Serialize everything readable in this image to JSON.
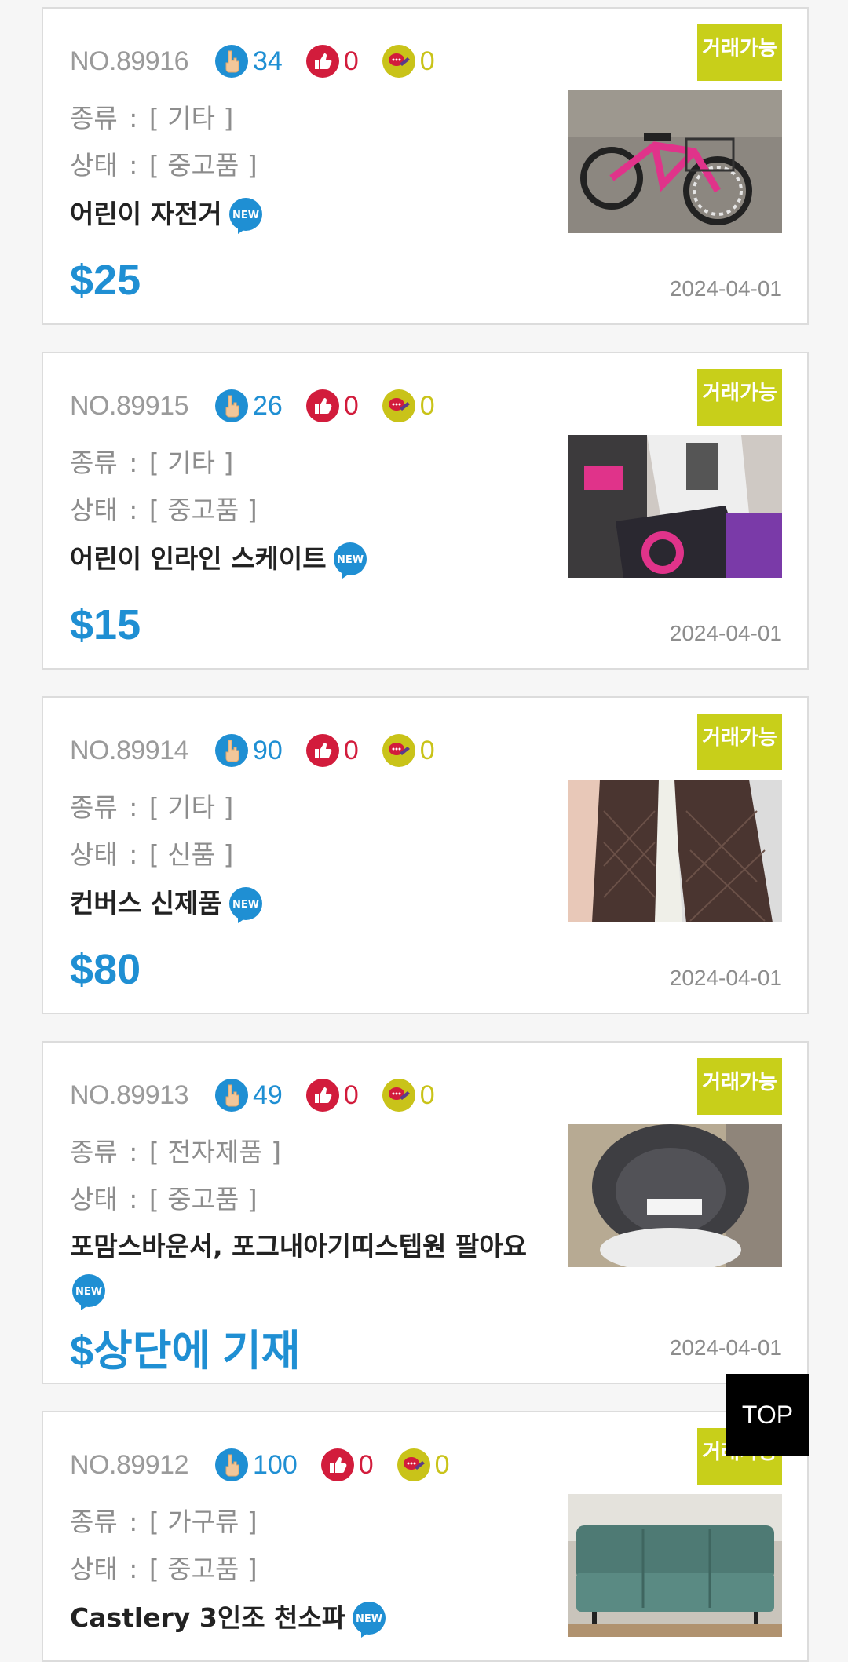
{
  "colors": {
    "accent_blue": "#1f8fd3",
    "like_red": "#d21c3c",
    "chat_olive": "#c9c319",
    "status_green": "#c8cf1a"
  },
  "labels": {
    "category_label": "종류",
    "condition_label": "상태",
    "colon": ":",
    "new_badge": "NEW"
  },
  "top_button": "TOP",
  "items": [
    {
      "no": "NO.89916",
      "views": "34",
      "likes": "0",
      "comments": "0",
      "category": "[ 기타 ]",
      "condition": "[ 중고품 ]",
      "title": "어린이 자전거",
      "price": "$25",
      "date": "2024-04-01",
      "status": "거래가능",
      "thumbnail_icon": "bicycle-photo"
    },
    {
      "no": "NO.89915",
      "views": "26",
      "likes": "0",
      "comments": "0",
      "category": "[ 기타 ]",
      "condition": "[ 중고품 ]",
      "title": "어린이 인라인 스케이트",
      "price": "$15",
      "date": "2024-04-01",
      "status": "거래가능",
      "thumbnail_icon": "inline-skate-photo"
    },
    {
      "no": "NO.89914",
      "views": "90",
      "likes": "0",
      "comments": "0",
      "category": "[ 기타 ]",
      "condition": "[ 신품 ]",
      "title": "컨버스 신제품",
      "price": "$80",
      "date": "2024-04-01",
      "status": "거래가능",
      "thumbnail_icon": "shoe-sole-photo"
    },
    {
      "no": "NO.89913",
      "views": "49",
      "likes": "0",
      "comments": "0",
      "category": "[ 전자제품 ]",
      "condition": "[ 중고품 ]",
      "title": "포맘스바운서, 포그내아기띠스텝원 팔아요",
      "price": "$상단에 기재",
      "date": "2024-04-01",
      "status": "거래가능",
      "thumbnail_icon": "baby-bouncer-photo"
    },
    {
      "no": "NO.89912",
      "views": "100",
      "likes": "0",
      "comments": "0",
      "category": "[ 가구류 ]",
      "condition": "[ 중고품 ]",
      "title": "Castlery 3인조 천소파",
      "price": "",
      "date": "",
      "status": "거래가능",
      "thumbnail_icon": "sofa-photo"
    }
  ]
}
